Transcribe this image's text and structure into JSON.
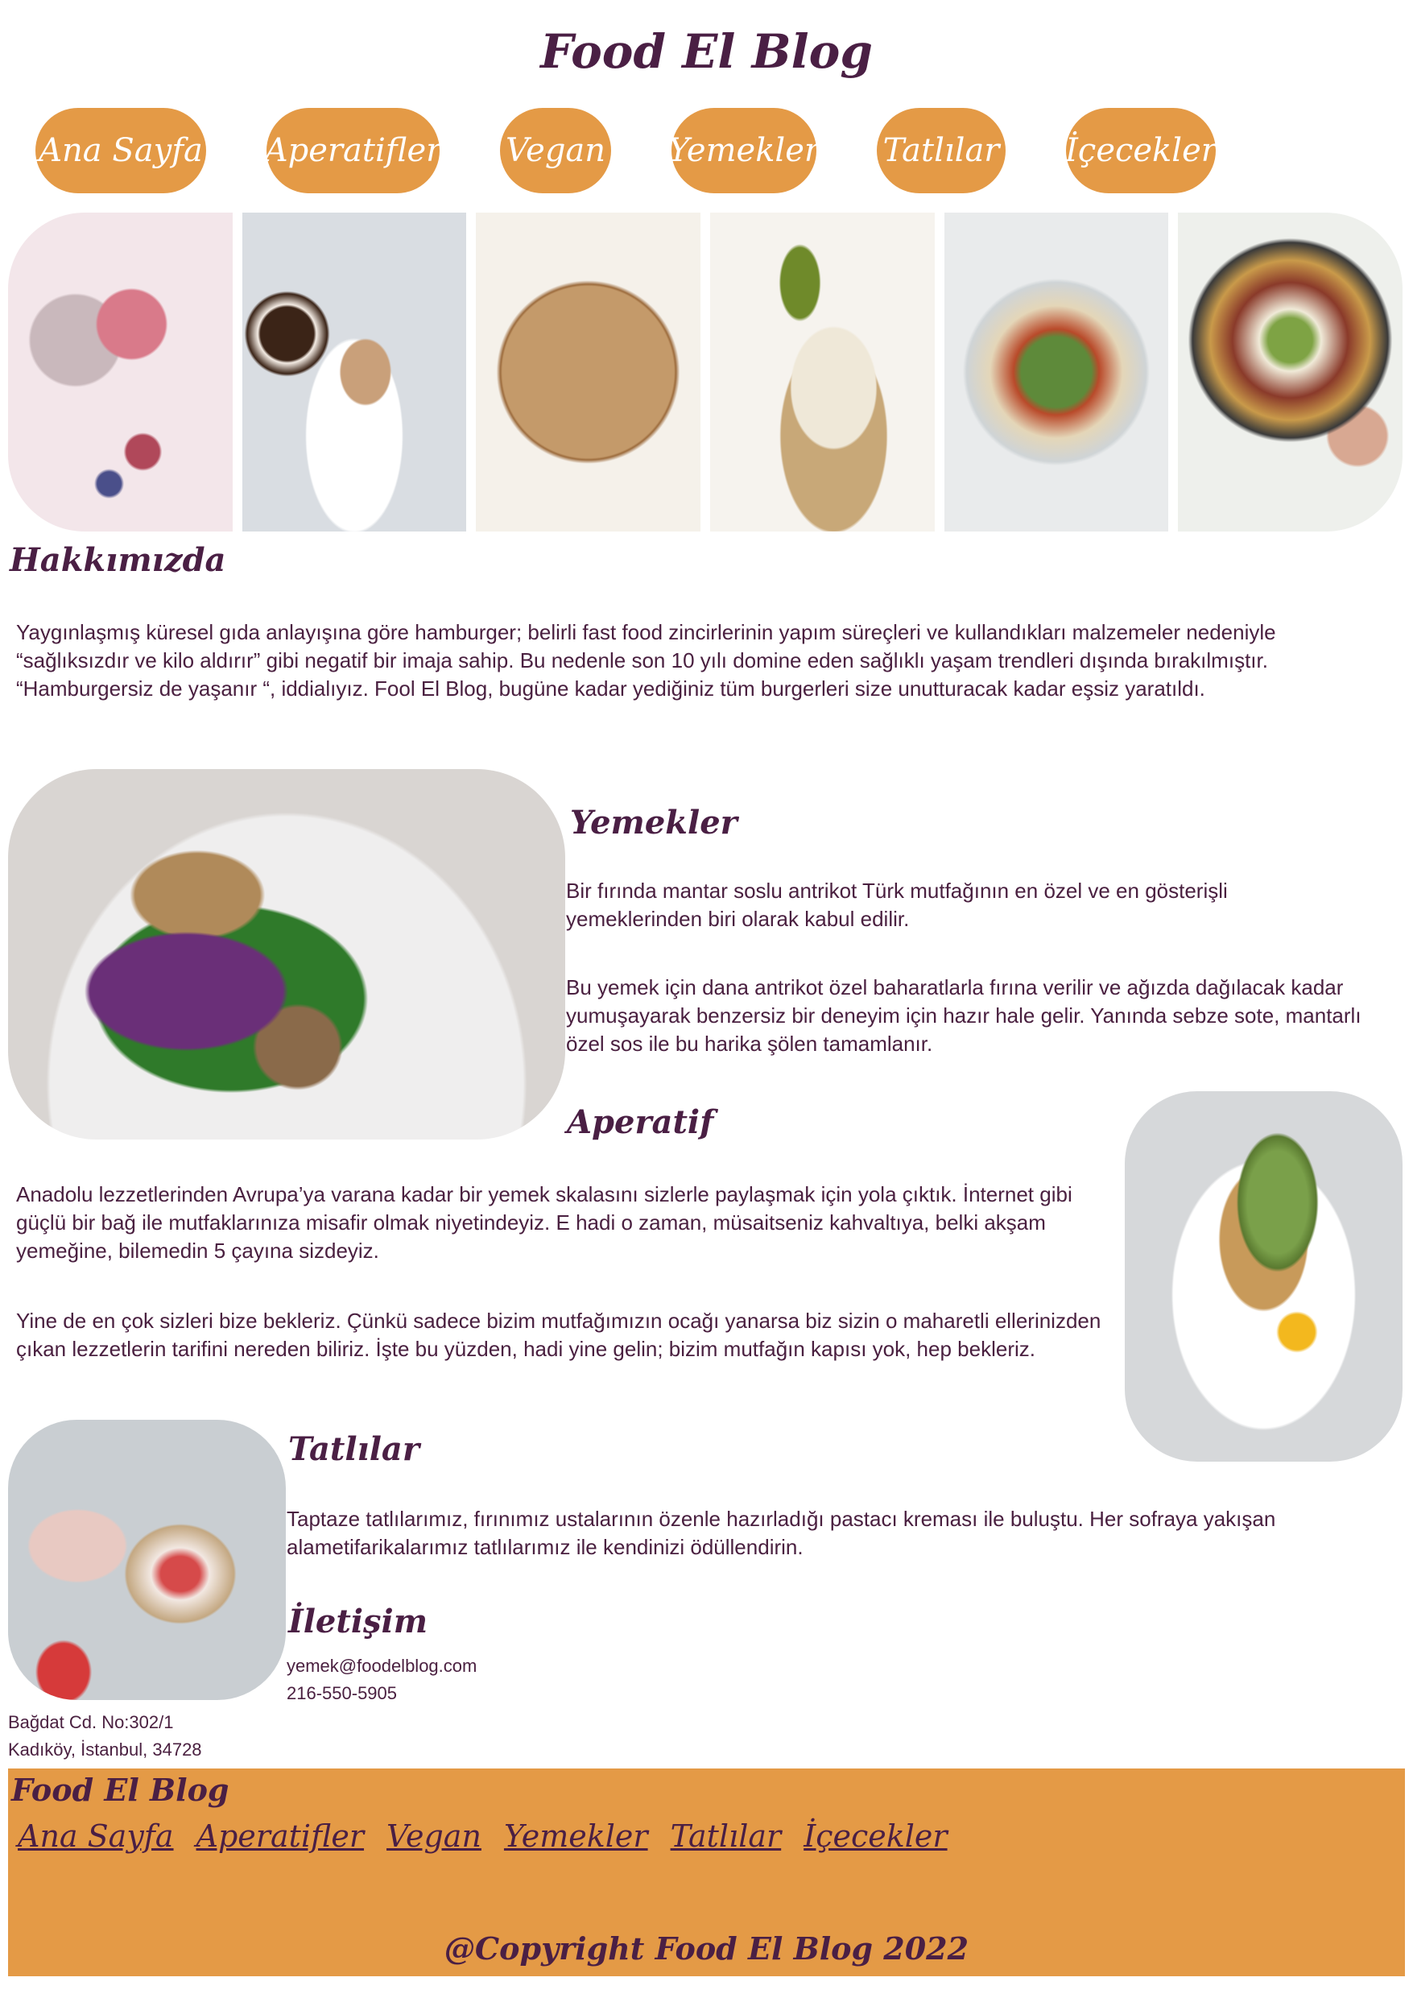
{
  "site": {
    "title": "Food El Blog"
  },
  "nav": {
    "items": [
      "Ana Sayfa",
      "Aperatifler",
      "Vegan",
      "Yemekler",
      "Tatlılar",
      "İçecekler"
    ],
    "color": "#e49a46"
  },
  "about": {
    "title": "Hakkımızda",
    "text": "Yaygınlaşmış küresel gıda anlayışına göre hamburger; belirli fast food zincirlerinin yapım süreçleri ve kullandıkları malzemeler nedeniyle “sağlıksızdır ve kilo aldırır” gibi negatif bir imaja sahip. Bu nedenle son 10 yılı domine eden sağlıklı yaşam trendleri dışında bırakılmıştır. “Hamburgersiz de yaşanır “, iddialıyız. Fool El Blog, bugüne kadar yediğiniz tüm burgerleri size unutturacak kadar eşsiz yaratıldı."
  },
  "dishes": {
    "title": "Yemekler",
    "p1": "Bir fırında mantar soslu antrikot Türk mutfağının en özel ve en gösterişli yemeklerinden biri olarak kabul edilir.",
    "p2": "Bu yemek için dana antrikot özel baharatlarla fırına verilir ve ağızda dağılacak kadar yumuşayarak benzersiz bir deneyim için hazır hale gelir. Yanında sebze sote, mantarlı özel sos ile bu harika şölen tamamlanır."
  },
  "appetizer": {
    "title": "Aperatif",
    "p1": "Anadolu lezzetlerinden Avrupa’ya varana kadar bir yemek skalasını sizlerle paylaşmak için yola çıktık. İnternet gibi güçlü bir bağ ile mutfaklarınıza misafir olmak niyetindeyiz. E hadi o zaman, müsaitseniz kahvaltıya, belki akşam yemeğine, bilemedin 5 çayına sizdeyiz.",
    "p2": "Yine de en çok sizleri bize bekleriz. Çünkü sadece bizim mutfağımızın ocağı yanarsa biz sizin o maharetli ellerinizden çıkan lezzetlerin tarifini nereden biliriz. İşte bu yüzden, hadi yine gelin; bizim mutfağın kapısı yok, hep bekleriz."
  },
  "desserts": {
    "title": "Tatlılar",
    "text": "Taptaze tatlılarımız, fırınımız ustalarının özenle hazırladığı pastacı kreması ile buluştu. Her sofraya yakışan alametifarikalarımız tatlılarımız ile kendinizi ödüllendirin."
  },
  "contact": {
    "title": "İletişim",
    "email": "yemek@foodelblog.com",
    "phone": "216-550-5905",
    "address1": "Bağdat Cd. No:302/1",
    "address2": "Kadıköy, İstanbul, 34728"
  },
  "footer": {
    "title": "Food El Blog",
    "nav": [
      "Ana Sayfa",
      "Aperatifler",
      "Vegan",
      "Yemekler",
      "Tatlılar",
      "İçecekler"
    ],
    "copyright": "@Copyright Food El Blog 2022"
  }
}
